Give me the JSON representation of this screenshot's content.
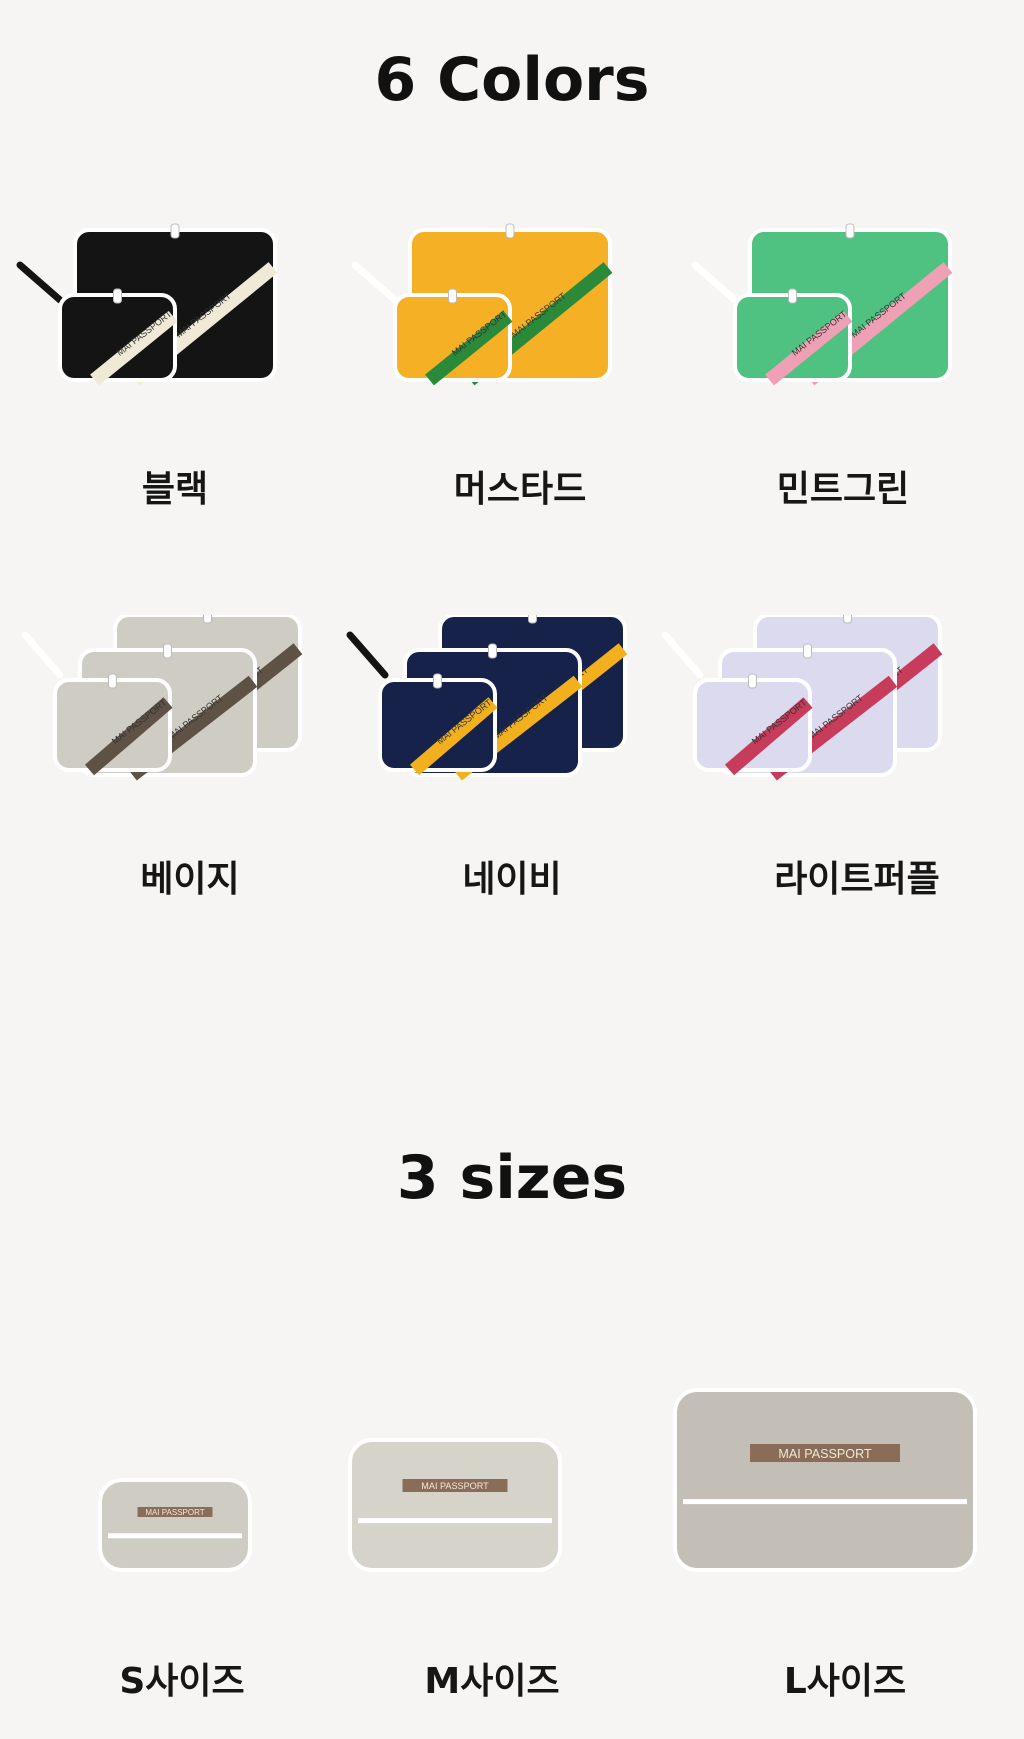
{
  "headings": {
    "colors": "6 Colors",
    "sizes": "3 sizes"
  },
  "brand_tag": "MAI PASSPORT",
  "colors": [
    {
      "label": "블랙",
      "bag": "#141414",
      "stripe": "#efe9d6",
      "trim": "#ffffff",
      "strap": "#141414",
      "style": "pair"
    },
    {
      "label": "머스타드",
      "bag": "#f5b026",
      "stripe": "#2b8a3a",
      "trim": "#ffffff",
      "strap": "#ffffff",
      "style": "pair"
    },
    {
      "label": "민트그린",
      "bag": "#4fc181",
      "stripe": "#f0a0b4",
      "trim": "#ffffff",
      "strap": "#ffffff",
      "style": "pair"
    },
    {
      "label": "베이지",
      "bag": "#cfccc4",
      "stripe": "#5e5246",
      "trim": "#ffffff",
      "strap": "#ffffff",
      "style": "trio"
    },
    {
      "label": "네이비",
      "bag": "#16224a",
      "stripe": "#f2b01e",
      "trim": "#ffffff",
      "strap": "#141414",
      "style": "trio"
    },
    {
      "label": "라이트퍼플",
      "bag": "#dcdaee",
      "stripe": "#c73c5a",
      "trim": "#ffffff",
      "strap": "#ffffff",
      "style": "trio"
    }
  ],
  "sizes": [
    {
      "label": "S사이즈",
      "bag": "#cfccc4",
      "stripe": "#8a6d58"
    },
    {
      "label": "M사이즈",
      "bag": "#d6d3cb",
      "stripe": "#8a6d58"
    },
    {
      "label": "L사이즈",
      "bag": "#c3bfb6",
      "stripe": "#8a6d58"
    }
  ]
}
